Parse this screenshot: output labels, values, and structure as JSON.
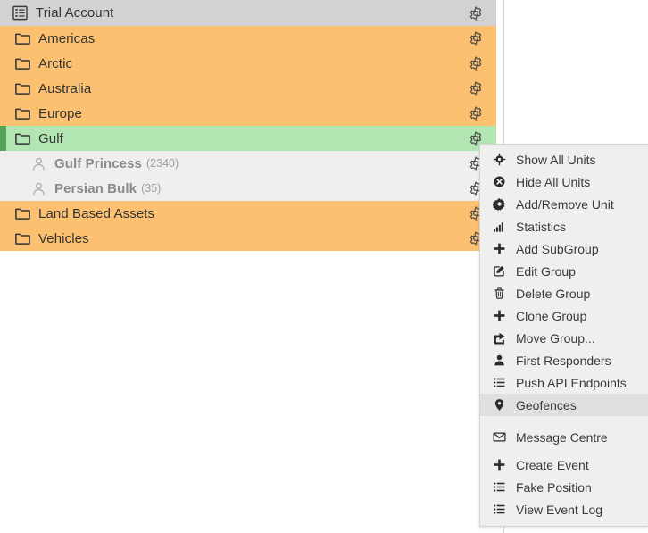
{
  "tree": {
    "rows": [
      {
        "label": "Trial Account",
        "type": "account",
        "icon": "list-table-icon",
        "indent": 0,
        "gear": true
      },
      {
        "label": "Americas",
        "type": "group",
        "icon": "folder-icon",
        "indent": 1,
        "gear": true
      },
      {
        "label": "Arctic",
        "type": "group",
        "icon": "folder-icon",
        "indent": 1,
        "gear": true
      },
      {
        "label": "Australia",
        "type": "group",
        "icon": "folder-icon",
        "indent": 1,
        "gear": true
      },
      {
        "label": "Europe",
        "type": "group",
        "icon": "folder-icon",
        "indent": 1,
        "gear": true
      },
      {
        "label": "Gulf",
        "type": "group-selected",
        "icon": "folder-icon",
        "indent": 1,
        "gear": true
      },
      {
        "label": "Gulf Princess",
        "id": "(2340)",
        "type": "unit",
        "icon": "person-outline-icon",
        "indent": 2,
        "gear": true
      },
      {
        "label": "Persian Bulk",
        "id": "(35)",
        "type": "unit",
        "icon": "person-outline-icon",
        "indent": 2,
        "gear": true
      },
      {
        "label": "Land Based Assets",
        "type": "group",
        "icon": "folder-icon",
        "indent": 1,
        "gear": true
      },
      {
        "label": "Vehicles",
        "type": "group",
        "icon": "folder-icon",
        "indent": 1,
        "gear": true
      }
    ]
  },
  "context_menu": {
    "items": [
      {
        "label": "Show All Units",
        "icon": "crosshair-icon",
        "highlighted": false
      },
      {
        "label": "Hide All Units",
        "icon": "x-circle-icon",
        "highlighted": false
      },
      {
        "label": "Add/Remove Unit",
        "icon": "gear-solid-icon",
        "highlighted": false
      },
      {
        "label": "Statistics",
        "icon": "bar-chart-icon",
        "highlighted": false
      },
      {
        "label": "Add SubGroup",
        "icon": "plus-icon",
        "highlighted": false
      },
      {
        "label": "Edit Group",
        "icon": "pencil-square-icon",
        "highlighted": false
      },
      {
        "label": "Delete Group",
        "icon": "trash-icon",
        "highlighted": false
      },
      {
        "label": "Clone Group",
        "icon": "plus-icon",
        "highlighted": false
      },
      {
        "label": "Move Group...",
        "icon": "share-arrow-icon",
        "highlighted": false
      },
      {
        "label": "First Responders",
        "icon": "person-solid-icon",
        "highlighted": false
      },
      {
        "label": "Push API Endpoints",
        "icon": "list-icon",
        "highlighted": false
      },
      {
        "label": "Geofences",
        "icon": "map-pin-icon",
        "highlighted": true
      },
      {
        "separator": true
      },
      {
        "label": "Message Centre",
        "icon": "envelope-icon",
        "highlighted": false
      },
      {
        "gap": true
      },
      {
        "label": "Create Event",
        "icon": "plus-icon",
        "highlighted": false
      },
      {
        "label": "Fake Position",
        "icon": "list-icon",
        "highlighted": false
      },
      {
        "label": "View Event Log",
        "icon": "list-icon",
        "highlighted": false
      }
    ]
  },
  "colors": {
    "group_bg": "#fcc071",
    "group_selected_bg": "#b1e5b1",
    "selection_bar": "#56a256",
    "account_bg": "#d2d2d2",
    "unit_bg": "#efefef",
    "menu_bg": "#efefef",
    "menu_highlight": "#e0e0e0"
  }
}
